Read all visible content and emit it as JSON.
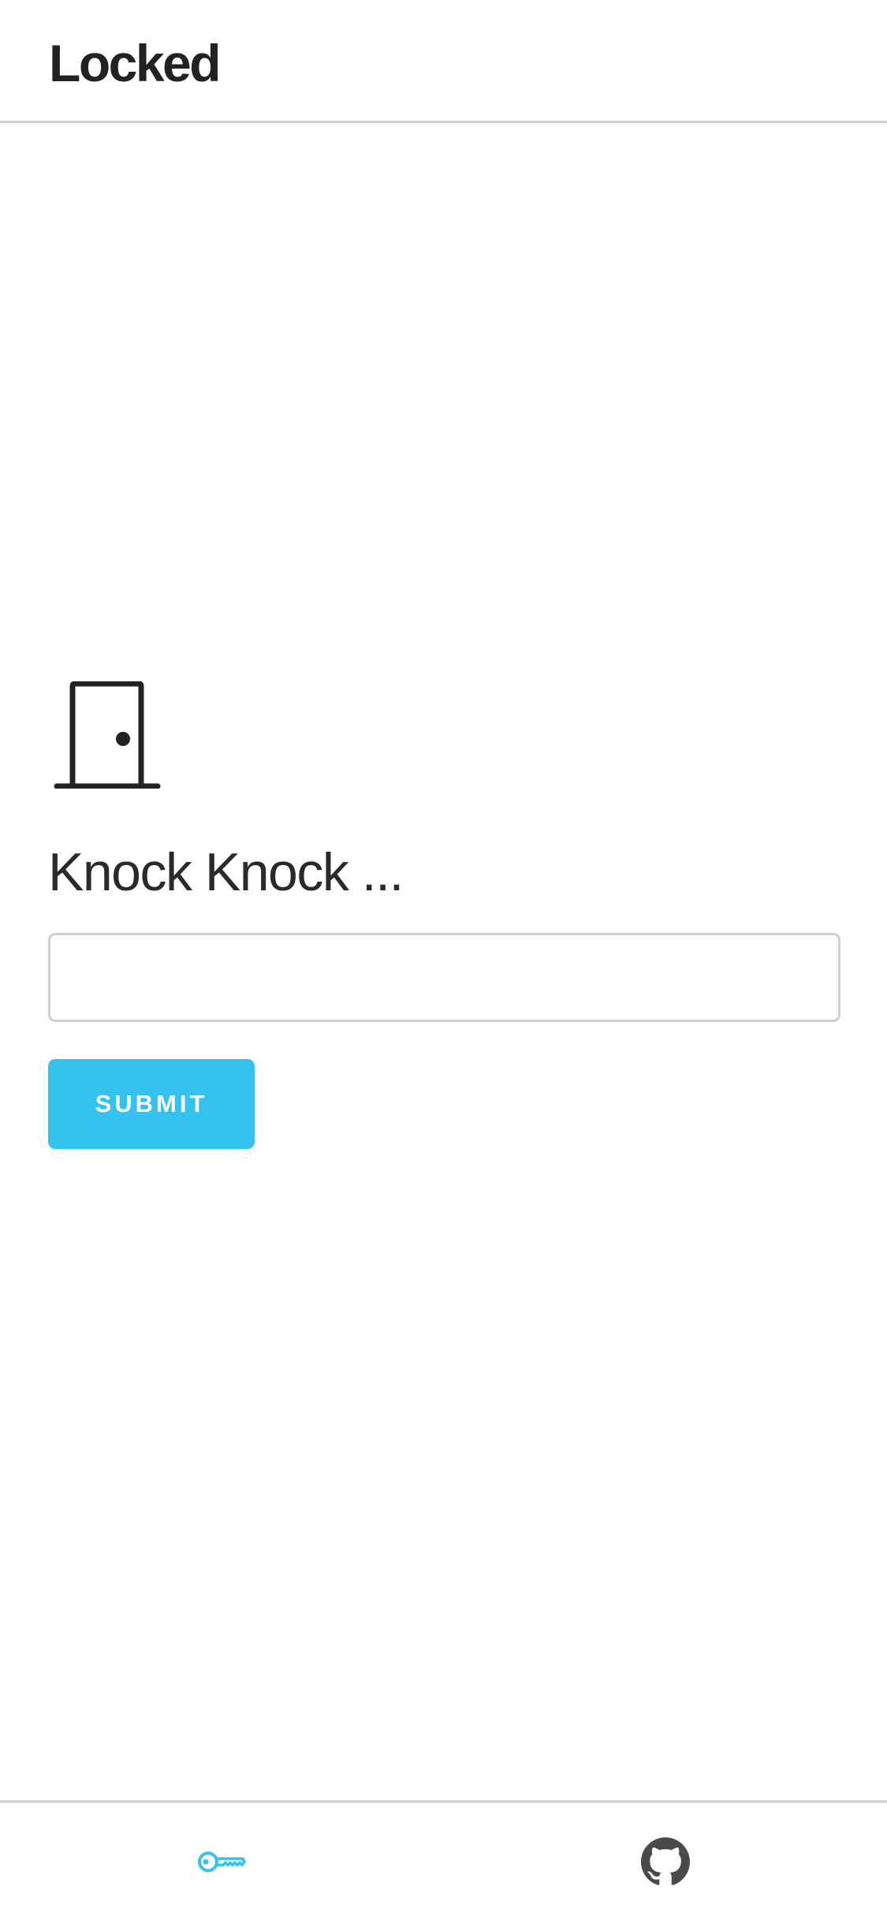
{
  "header": {
    "title": "Locked"
  },
  "main": {
    "icon": "door-icon",
    "prompt": "Knock Knock ...",
    "input": {
      "value": "",
      "placeholder": ""
    },
    "submit_label": "SUBMIT"
  },
  "tabbar": {
    "tabs": [
      {
        "icon": "key-icon",
        "active": true
      },
      {
        "icon": "github-icon",
        "active": false
      }
    ]
  },
  "colors": {
    "accent": "#35c2ee",
    "text": "#222222",
    "divider": "#d2d2d2",
    "inactive_icon": "#4a4a4a"
  }
}
